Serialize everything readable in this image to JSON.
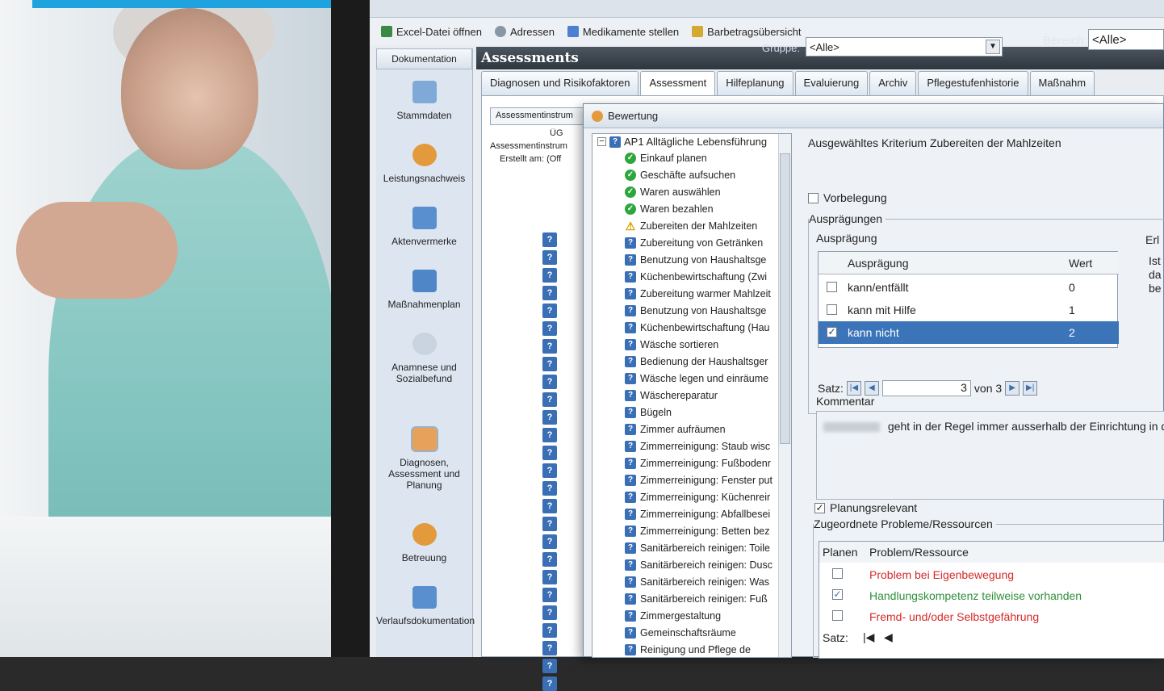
{
  "toolbar": {
    "items": [
      {
        "label": "Excel-Datei öffnen",
        "icon": "excel-icon"
      },
      {
        "label": "Adressen",
        "icon": "address-book-icon"
      },
      {
        "label": "Medikamente stellen",
        "icon": "medication-icon"
      },
      {
        "label": "Barbetragsübersicht",
        "icon": "money-icon"
      }
    ]
  },
  "nav": {
    "header": "Dokumentation",
    "items": [
      {
        "label": "Stammdaten",
        "color": "#7fa9d6"
      },
      {
        "label": "Leistungsnachweis",
        "color": "#e29a3c"
      },
      {
        "label": "Aktenvermerke",
        "color": "#5a8fcf"
      },
      {
        "label": "Maßnahmenplan",
        "color": "#4e86c8"
      },
      {
        "label": "Anamnese und Sozialbefund",
        "color": "#c9d4e0"
      },
      {
        "label": "Diagnosen, Assessment und Planung",
        "color": "#e8a15a"
      },
      {
        "label": "Betreuung",
        "color": "#e29a3c"
      },
      {
        "label": "Verlaufsdokumentation",
        "color": "#5a8fcf"
      }
    ]
  },
  "main": {
    "title": "Assessments",
    "gruppe_label": "Gruppe:",
    "gruppe_value": "<Alle>",
    "bereich_label": "Bereich:",
    "bereich_value": "<Alle>",
    "tabs": [
      "Diagnosen und Risikofaktoren",
      "Assessment",
      "Hilfeplanung",
      "Evaluierung",
      "Archiv",
      "Pflegestufenhistorie",
      "Maßnahm"
    ],
    "grid_header": "Assessmentinstrum",
    "grid_col": "ÜG",
    "grid_rows": [
      "Assessmentinstrum",
      "Erstellt am: (Off"
    ]
  },
  "dialog": {
    "title": "Bewertung",
    "tree_root": "AP1 Alltägliche Lebensführung",
    "tree_items": [
      {
        "label": "Einkauf planen",
        "status": "ok"
      },
      {
        "label": "Geschäfte aufsuchen",
        "status": "ok"
      },
      {
        "label": "Waren auswählen",
        "status": "ok"
      },
      {
        "label": "Waren bezahlen",
        "status": "ok"
      },
      {
        "label": "Zubereiten der Mahlzeiten",
        "status": "warn"
      },
      {
        "label": "Zubereitung von Getränken",
        "status": "q"
      },
      {
        "label": "Benutzung von Haushaltsge",
        "status": "q"
      },
      {
        "label": "Küchenbewirtschaftung (Zwi",
        "status": "q"
      },
      {
        "label": "Zubereitung warmer Mahlzeit",
        "status": "q"
      },
      {
        "label": "Benutzung von Haushaltsge",
        "status": "q"
      },
      {
        "label": "Küchenbewirtschaftung (Hau",
        "status": "q"
      },
      {
        "label": "Wäsche sortieren",
        "status": "q"
      },
      {
        "label": "Bedienung der Haushaltsger",
        "status": "q"
      },
      {
        "label": "Wäsche legen und einräume",
        "status": "q"
      },
      {
        "label": "Wäschereparatur",
        "status": "q"
      },
      {
        "label": "Bügeln",
        "status": "q"
      },
      {
        "label": "Zimmer aufräumen",
        "status": "q"
      },
      {
        "label": "Zimmerreinigung: Staub wisc",
        "status": "q"
      },
      {
        "label": "Zimmerreinigung: Fußbodenr",
        "status": "q"
      },
      {
        "label": "Zimmerreinigung: Fenster put",
        "status": "q"
      },
      {
        "label": "Zimmerreinigung: Küchenreir",
        "status": "q"
      },
      {
        "label": "Zimmerreinigung: Abfallbesei",
        "status": "q"
      },
      {
        "label": "Zimmerreinigung: Betten bez",
        "status": "q"
      },
      {
        "label": "Sanitärbereich reinigen: Toile",
        "status": "q"
      },
      {
        "label": "Sanitärbereich reinigen: Dusc",
        "status": "q"
      },
      {
        "label": "Sanitärbereich reinigen: Was",
        "status": "q"
      },
      {
        "label": "Sanitärbereich reinigen: Fuß",
        "status": "q"
      },
      {
        "label": "Zimmergestaltung",
        "status": "q"
      },
      {
        "label": "Gemeinschaftsräume",
        "status": "q"
      },
      {
        "label": "Reinigung und Pflege de",
        "status": "q"
      }
    ],
    "criterion": "Ausgewähltes Kriterium Zubereiten der Mahlzeiten",
    "vorbelegung": "Vorbelegung",
    "auspraegungen_group": "Ausprägungen",
    "auspraegung_label": "Ausprägung",
    "erl_label": "Erl",
    "side_text": [
      "Ist",
      "da",
      "be"
    ],
    "table_headers": {
      "auspraegung": "Ausprägung",
      "wert": "Wert"
    },
    "options": [
      {
        "label": "kann/entfällt",
        "value": "0",
        "checked": false
      },
      {
        "label": "kann mit Hilfe",
        "value": "1",
        "checked": false
      },
      {
        "label": "kann nicht",
        "value": "2",
        "checked": true
      }
    ],
    "satz_label": "Satz:",
    "satz_current": "3",
    "satz_of": "von 3",
    "kommentar_label": "Kommentar",
    "kommentar_text": "geht in der Regel immer ausserhalb der Einrichtung in d",
    "planungsrelevant": "Planungsrelevant",
    "problems_group": "Zugeordnete Probleme/Ressourcen",
    "problems_headers": {
      "planen": "Planen",
      "problem": "Problem/Ressource"
    },
    "problems": [
      {
        "label": "Problem bei Eigenbewegung",
        "kind": "problem",
        "checked": false
      },
      {
        "label": "Handlungskompetenz teilweise vorhanden",
        "kind": "resource",
        "checked": true
      },
      {
        "label": "Fremd- und/oder Selbstgefährung",
        "kind": "problem",
        "checked": false
      }
    ],
    "problems_satz": "Satz:"
  }
}
